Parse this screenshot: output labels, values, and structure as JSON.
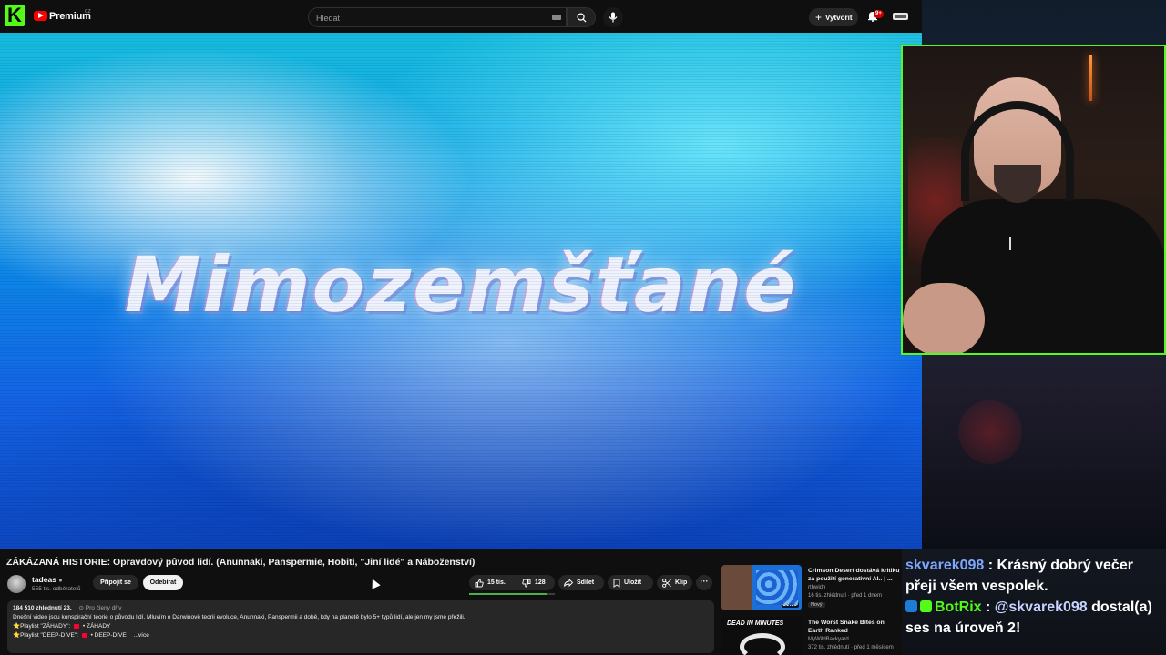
{
  "youtube": {
    "brand": "Premium",
    "country": "CZ",
    "search": {
      "placeholder": "Hledat"
    },
    "create_label": "Vytvořit",
    "notifications_count": "9+"
  },
  "video": {
    "overlay_text": "Mimozemšťané"
  },
  "info": {
    "title": "ZÁKÁZANÁ HISTORIE: Opravdový původ lidí. (Anunnaki, Panspermie, Hobiti, \"Jiní lidé\" a Náboženství)",
    "channel_name": "tadeas",
    "subscribers": "555 tis. odběratelů",
    "join_label": "Připojit se",
    "subscribe_label": "Odebírat",
    "likes": "15 tis.",
    "dislikes": "128",
    "share_label": "Sdílet",
    "save_label": "Uložit",
    "clip_label": "Klip",
    "more_label": "···",
    "description": {
      "views": "184 510 zhlédnutí",
      "date": "23.",
      "members_only": "Pro členy dřív",
      "text": "Dnešní video jsou konspirační teorie o původu lidí. Mluvím o Darwinově teorii evoluce, Anunnaki, Panspermii a době, kdy na planetě bylo 5+ typů lidí, ale jen my jsme přežili.",
      "playlist1_label": "⭐Playlist \"ZÁHADY\":",
      "playlist1_link": "• ZÁHADY",
      "playlist2_label": "⭐Playlist \"DEEP-DIVE\":",
      "playlist2_link": "• DEEP-DIVE",
      "more": "...více"
    }
  },
  "recommendations": [
    {
      "title": "Crimson Desert dostává kritiku za použití generativní AI.. | ...",
      "channel": "rthwidn",
      "views": "16 tis. zhlédnutí · před 1 dnem",
      "badge": "Nový",
      "duration": "30:30",
      "thumb_text": ""
    },
    {
      "title": "The Worst Snake Bites on Earth Ranked",
      "channel": "MyWildBackyard",
      "views": "372 tis. zhlédnutí · před 1 měsícem",
      "badge": "",
      "duration": "",
      "thumb_text": "DEAD IN MINUTES"
    }
  ],
  "chat": [
    {
      "user": "skvarek098",
      "separator": " : ",
      "message": "Krásný dobrý večer přeji všem vespolek."
    },
    {
      "user": "BotRix",
      "separator": " : ",
      "mention": "@skvarek098",
      "message": " dostal(a) ses na úroveň 2!"
    }
  ],
  "colors": {
    "kick_green": "#53fc18",
    "youtube_red": "#ff0000",
    "chat_user1": "#7fa7ff",
    "chat_user2": "#53fc18"
  }
}
